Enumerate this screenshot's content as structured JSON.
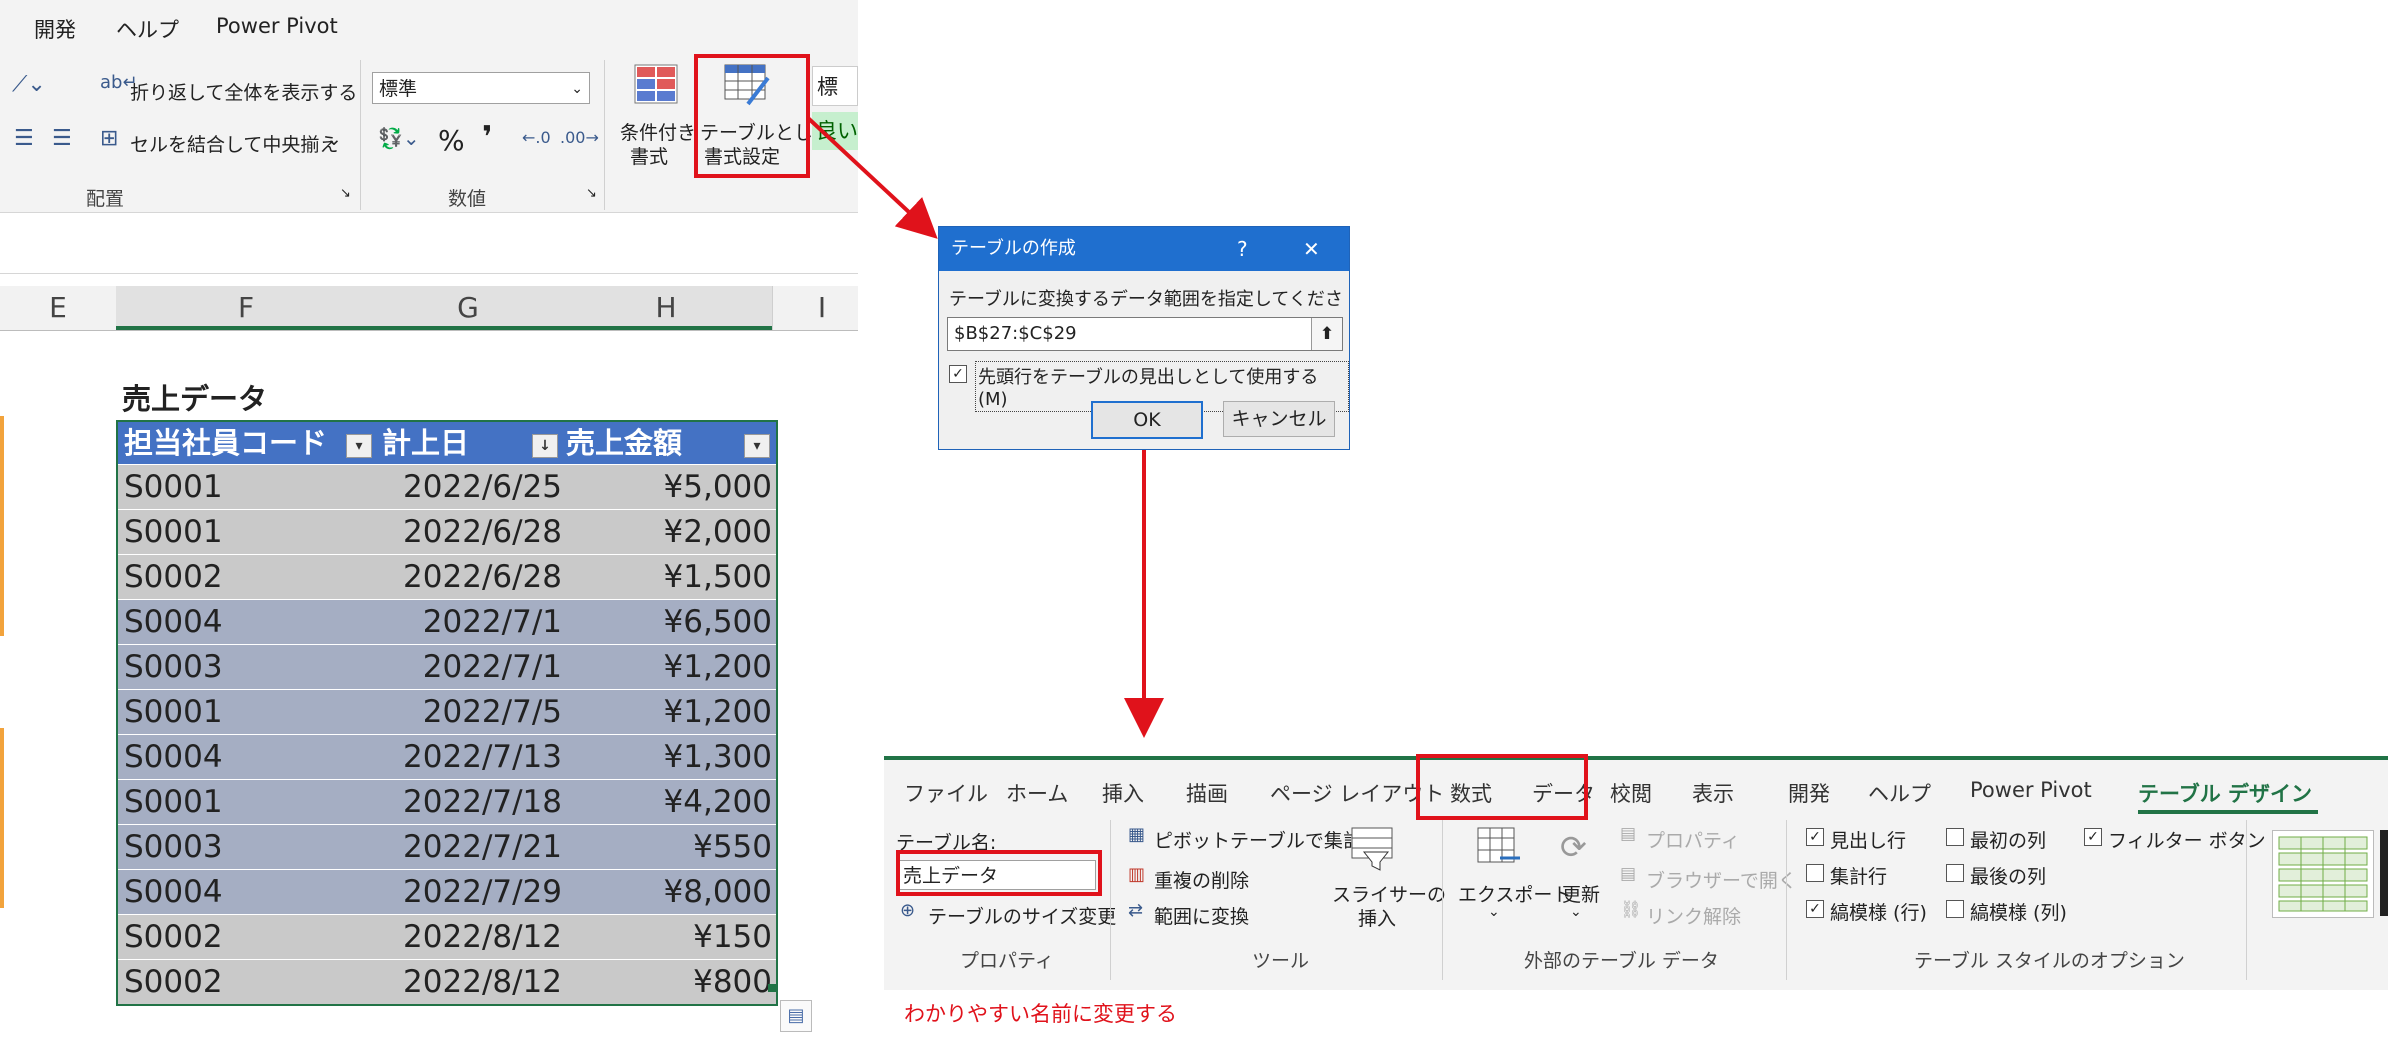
{
  "top_ribbon": {
    "tabs": [
      "開発",
      "ヘルプ",
      "Power Pivot"
    ],
    "wrap_text_label": "折り返して全体を表示する",
    "merge_center_label": "セルを結合して中央揃え",
    "number_format_value": "標準",
    "percent_symbol": "%",
    "comma_symbol": "❜",
    "conditional_format_label_1": "条件付き",
    "conditional_format_label_2": "書式",
    "format_as_table_label_1": "テーブルとして",
    "format_as_table_label_2": "書式設定",
    "style_preview_1": "標準",
    "style_preview_2": "良い",
    "group_alignment": "配置",
    "group_number": "数値"
  },
  "column_headers": [
    "E",
    "F",
    "G",
    "H",
    "I"
  ],
  "sheet_title": "売上データ",
  "table": {
    "headers": [
      "担当社員コード",
      "計上日",
      "売上金額"
    ],
    "rows": [
      [
        "S0001",
        "2022/6/25",
        "¥5,000"
      ],
      [
        "S0001",
        "2022/6/28",
        "¥2,000"
      ],
      [
        "S0002",
        "2022/6/28",
        "¥1,500"
      ],
      [
        "S0004",
        "2022/7/1",
        "¥6,500"
      ],
      [
        "S0003",
        "2022/7/1",
        "¥1,200"
      ],
      [
        "S0001",
        "2022/7/5",
        "¥1,200"
      ],
      [
        "S0004",
        "2022/7/13",
        "¥1,300"
      ],
      [
        "S0001",
        "2022/7/18",
        "¥4,200"
      ],
      [
        "S0003",
        "2022/7/21",
        "¥550"
      ],
      [
        "S0004",
        "2022/7/29",
        "¥8,000"
      ],
      [
        "S0002",
        "2022/8/12",
        "¥150"
      ],
      [
        "S0002",
        "2022/8/12",
        "¥800"
      ]
    ]
  },
  "dialog": {
    "title": "テーブルの作成",
    "help": "?",
    "close": "✕",
    "prompt": "テーブルに変換するデータ範囲を指定してください(W)",
    "range_value": "$B$27:$C$29",
    "header_checkbox_label": "先頭行をテーブルの見出しとして使用する(M)",
    "ok_label": "OK",
    "cancel_label": "キャンセル"
  },
  "bottom_ribbon": {
    "tabs": [
      "ファイル",
      "ホーム",
      "挿入",
      "描画",
      "ページ レイアウト",
      "数式",
      "データ",
      "校閲",
      "表示",
      "開発",
      "ヘルプ",
      "Power Pivot",
      "テーブル デザイン"
    ],
    "table_name_label": "テーブル名:",
    "table_name_value": "売上データ",
    "resize_table": "テーブルのサイズ変更",
    "group_properties": "プロパティ",
    "pivot_summary": "ピボットテーブルで集計",
    "remove_duplicates": "重複の削除",
    "convert_to_range": "範囲に変換",
    "slicer_1": "スライサーの",
    "slicer_2": "挿入",
    "group_tools": "ツール",
    "export": "エクスポート",
    "refresh": "更新",
    "properties": "プロパティ",
    "open_in_browser": "ブラウザーで開く",
    "unlink": "リンク解除",
    "group_external": "外部のテーブル データ",
    "header_row": "見出し行",
    "total_row": "集計行",
    "banded_rows": "縞模様 (行)",
    "first_column": "最初の列",
    "last_column": "最後の列",
    "banded_columns": "縞模様 (列)",
    "filter_button": "フィルター ボタン",
    "group_style_options": "テーブル スタイルのオプション"
  },
  "annotation": "わかりやすい名前に変更する",
  "colors": {
    "excel_green": "#217346",
    "table_header_blue": "#4472c4",
    "highlight_red": "#e0121b",
    "dialog_title_blue": "#1f6fcf"
  }
}
